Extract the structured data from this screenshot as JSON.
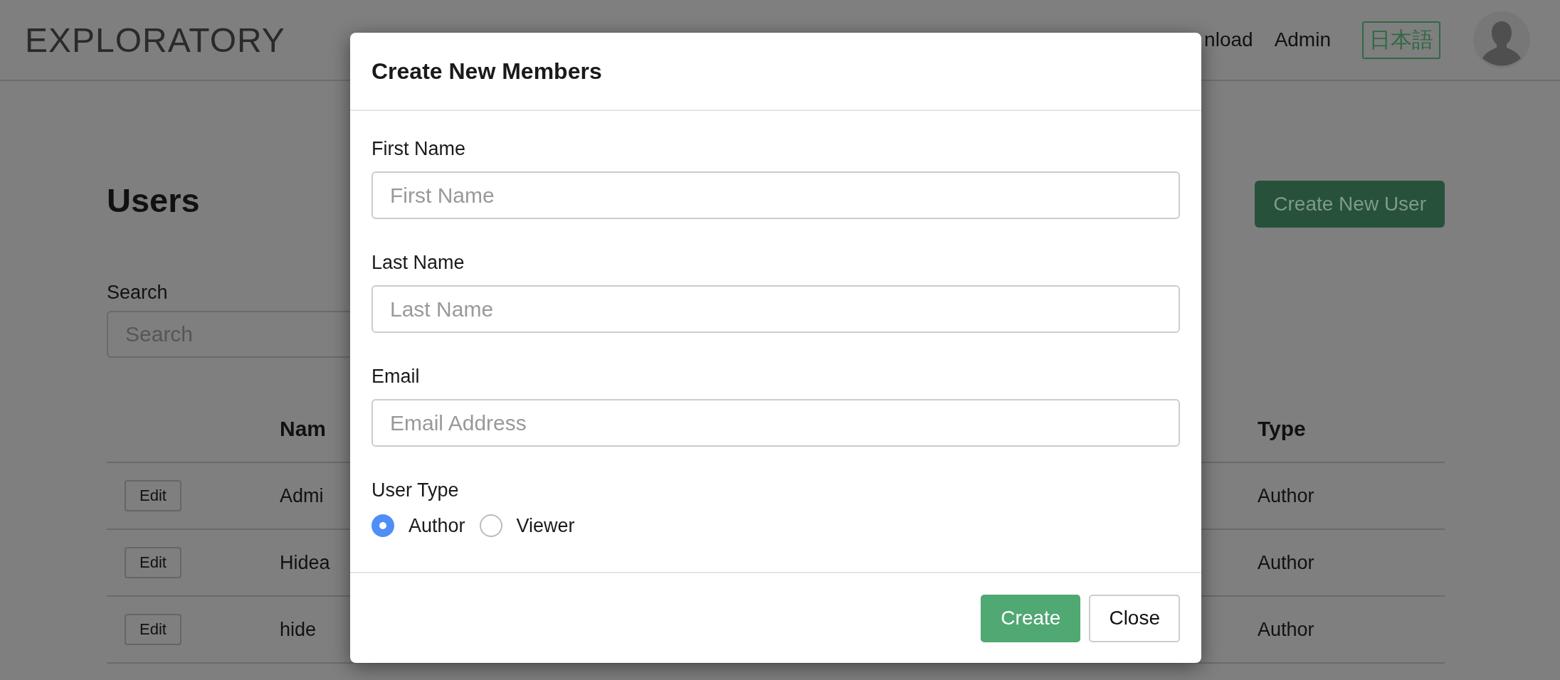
{
  "header": {
    "logo": "EXPLORATORY",
    "nav": [
      {
        "label": "nload"
      },
      {
        "label": "Admin"
      }
    ],
    "language_button": "日本語"
  },
  "page": {
    "title": "Users",
    "create_button": "Create New User",
    "search": {
      "label": "Search",
      "placeholder": "Search"
    },
    "table": {
      "columns": [
        {
          "label": "Nam"
        },
        {
          "label": "Type"
        }
      ],
      "rows": [
        {
          "action": "Edit",
          "name": "Admi",
          "type": "Author"
        },
        {
          "action": "Edit",
          "name": "Hidea",
          "type": "Author"
        },
        {
          "action": "Edit",
          "name": "hide",
          "type": "Author"
        }
      ]
    }
  },
  "modal": {
    "title": "Create New Members",
    "fields": [
      {
        "label": "First Name",
        "placeholder": "First Name"
      },
      {
        "label": "Last Name",
        "placeholder": "Last Name"
      },
      {
        "label": "Email",
        "placeholder": "Email Address"
      }
    ],
    "user_type": {
      "label": "User Type",
      "options": [
        {
          "label": "Author",
          "selected": true
        },
        {
          "label": "Viewer",
          "selected": false
        }
      ]
    },
    "buttons": [
      {
        "label": "Create",
        "kind": "primary"
      },
      {
        "label": "Close",
        "kind": "default"
      }
    ]
  }
}
